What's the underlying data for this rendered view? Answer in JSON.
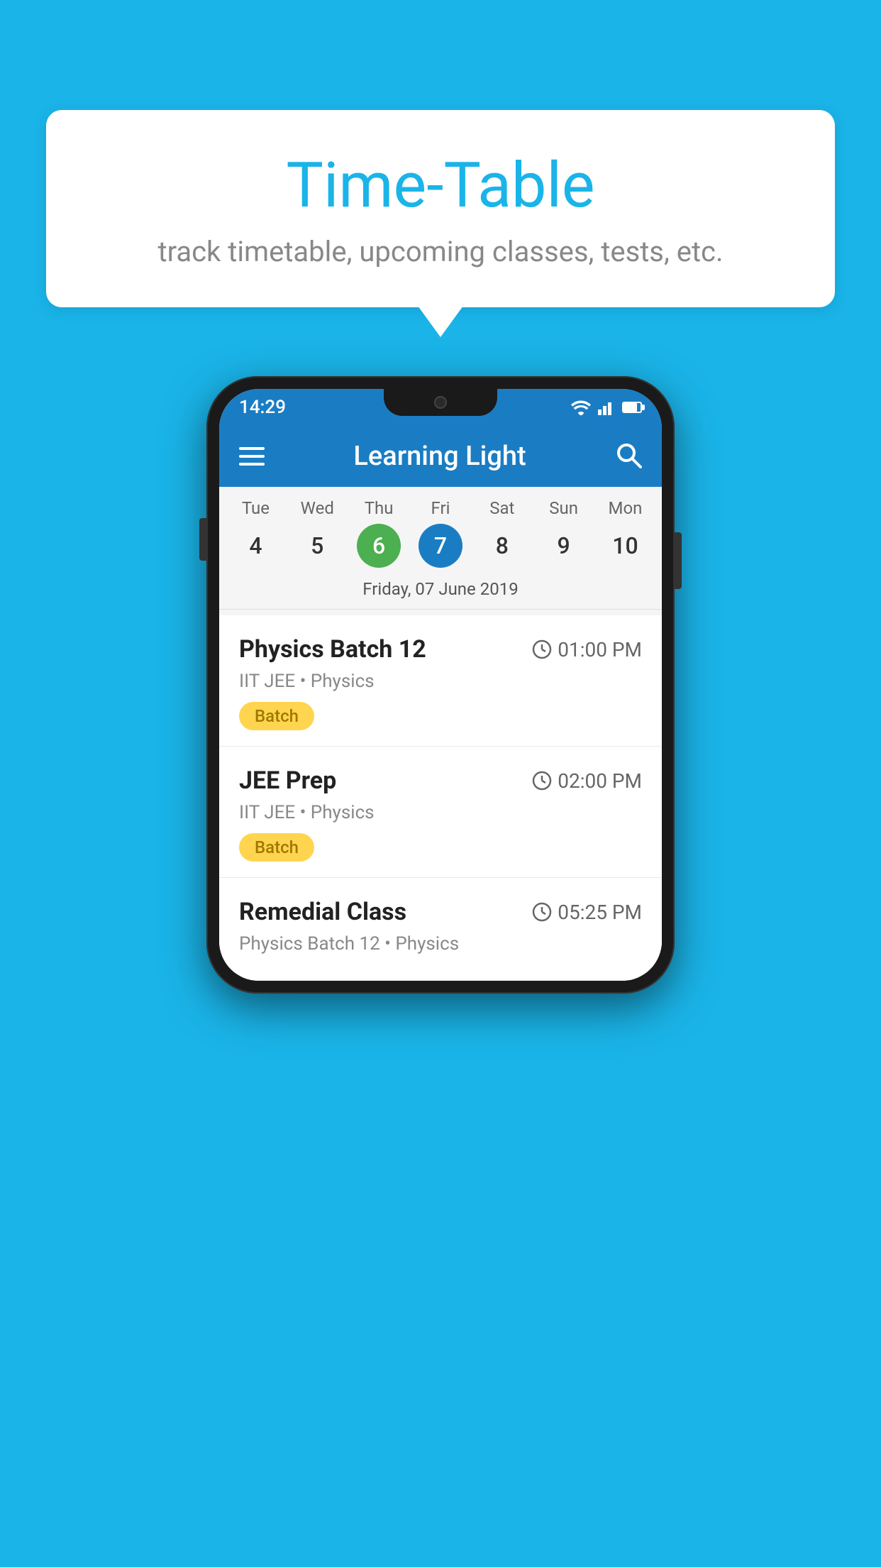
{
  "background_color": "#1ab4e8",
  "bubble": {
    "title": "Time-Table",
    "subtitle": "track timetable, upcoming classes, tests, etc."
  },
  "phone": {
    "status_bar": {
      "time": "14:29"
    },
    "app_bar": {
      "title": "Learning Light"
    },
    "calendar": {
      "days": [
        {
          "name": "Tue",
          "num": "4",
          "state": "normal"
        },
        {
          "name": "Wed",
          "num": "5",
          "state": "normal"
        },
        {
          "name": "Thu",
          "num": "6",
          "state": "today"
        },
        {
          "name": "Fri",
          "num": "7",
          "state": "selected"
        },
        {
          "name": "Sat",
          "num": "8",
          "state": "normal"
        },
        {
          "name": "Sun",
          "num": "9",
          "state": "normal"
        },
        {
          "name": "Mon",
          "num": "10",
          "state": "normal"
        }
      ],
      "selected_date": "Friday, 07 June 2019"
    },
    "schedule": [
      {
        "name": "Physics Batch 12",
        "time": "01:00 PM",
        "sub": "IIT JEE • Physics",
        "badge": "Batch"
      },
      {
        "name": "JEE Prep",
        "time": "02:00 PM",
        "sub": "IIT JEE • Physics",
        "badge": "Batch"
      },
      {
        "name": "Remedial Class",
        "time": "05:25 PM",
        "sub": "Physics Batch 12 • Physics",
        "badge": null
      }
    ]
  }
}
